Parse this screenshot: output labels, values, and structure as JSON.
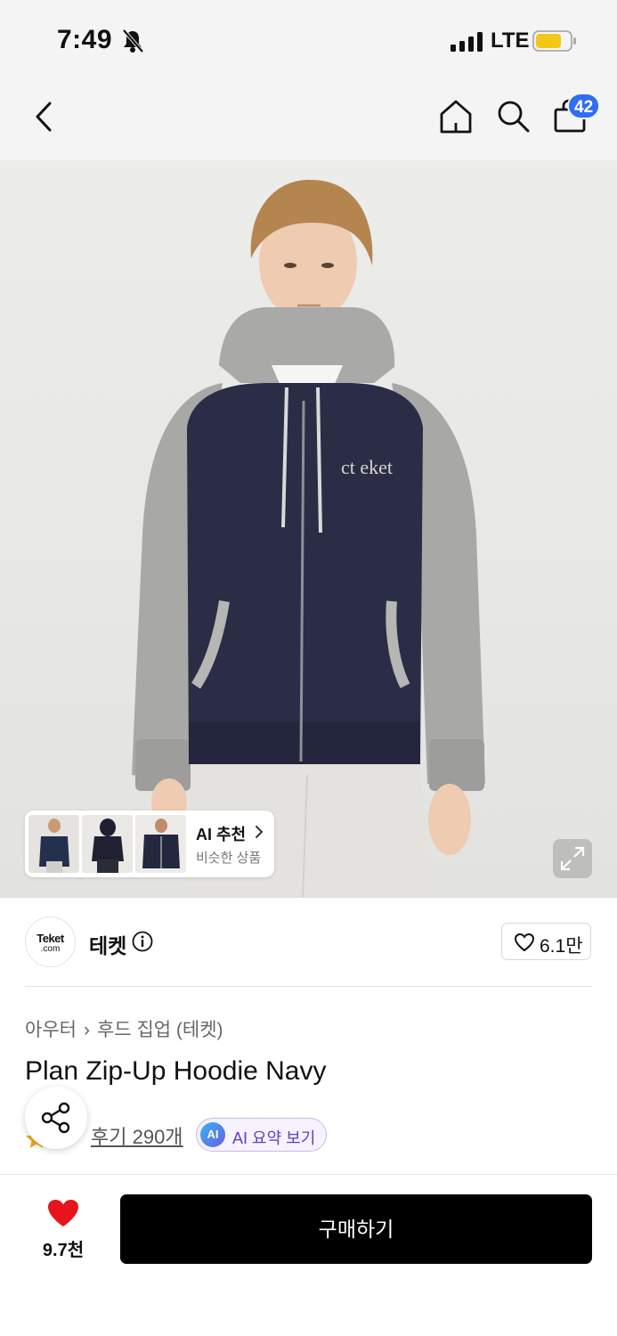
{
  "status_bar": {
    "time": "7:49",
    "network": "LTE"
  },
  "nav": {
    "cart_count": "42"
  },
  "hero": {
    "logo_text": "ct eket",
    "ai_recommend": {
      "title": "AI 추천",
      "subtitle": "비슷한 상품"
    }
  },
  "brand": {
    "logo_line1": "Teket",
    "logo_line2": ".com",
    "name": "테켓",
    "likes": "6.1만"
  },
  "product": {
    "breadcrumb": [
      "아우터",
      "후드 집업 (테켓)"
    ],
    "title": "Plan Zip-Up Hoodie Navy",
    "reviews_label": "후기 290개",
    "ai_badge": "AI",
    "ai_summary_label": "AI 요약 보기"
  },
  "bottom_bar": {
    "wish_count": "9.7천",
    "buy_label": "구매하기"
  },
  "colors": {
    "accent_blue": "#2f6ef0",
    "heart_red": "#e8141b",
    "buy_button": "#000000",
    "ai_purple": "#5b3fc4"
  }
}
